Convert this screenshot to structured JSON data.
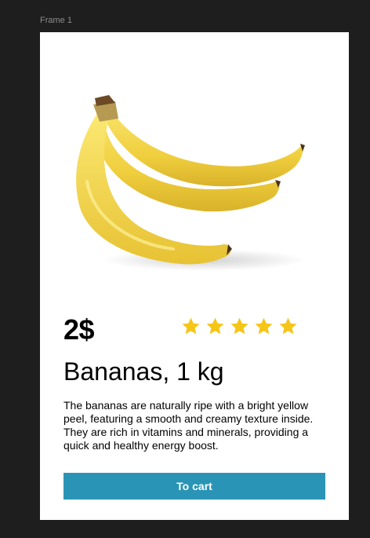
{
  "canvas": {
    "frame_label": "Frame 1"
  },
  "product": {
    "image_icon": "banana-bunch-image",
    "price": "2$",
    "rating": 5,
    "rating_max": 5,
    "title": "Bananas, 1 kg",
    "description": "The bananas are naturally ripe with a bright yellow peel, featuring a smooth and creamy texture inside. They are rich in vitamins and minerals, providing a quick and healthy energy boost.",
    "cart_button_label": "To cart"
  },
  "colors": {
    "canvas_bg": "#1e1e1e",
    "card_bg": "#ffffff",
    "star": "#f5c518",
    "button": "#2a94b6",
    "button_text": "#ffffff",
    "banana": "#f3d54a"
  }
}
